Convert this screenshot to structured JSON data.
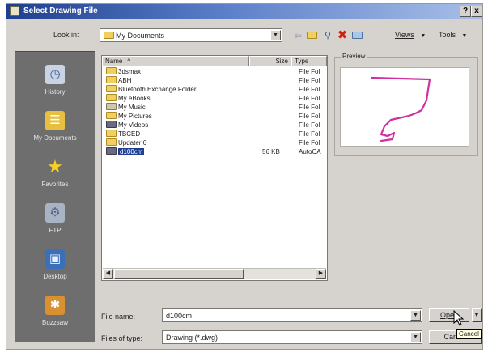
{
  "window": {
    "title": "Select Drawing File",
    "help_btn": "?",
    "close_btn": "x"
  },
  "lookin": {
    "label": "Look in:",
    "value": "My Documents"
  },
  "toolbar": {
    "back_icon": "back-arrow",
    "up_icon": "up-folder",
    "search_icon": "search-web",
    "delete_icon": "delete-x",
    "newfolder_icon": "new-folder",
    "views_label": "Views",
    "tools_label": "Tools",
    "dropdown": "▼"
  },
  "places": [
    {
      "label": "History",
      "icon": "history-icon"
    },
    {
      "label": "My Documents",
      "icon": "my-documents-icon"
    },
    {
      "label": "Favorites",
      "icon": "favorites-icon"
    },
    {
      "label": "FTP",
      "icon": "ftp-icon"
    },
    {
      "label": "Desktop",
      "icon": "desktop-icon"
    },
    {
      "label": "Buzzsaw",
      "icon": "buzzsaw-icon"
    }
  ],
  "filelist": {
    "columns": {
      "name": "Name",
      "size": "Size",
      "type": "Type"
    },
    "rows": [
      {
        "name": "3dsmax",
        "size": "",
        "type": "File Fol",
        "kind": "folder"
      },
      {
        "name": "ABH",
        "size": "",
        "type": "File Fol",
        "kind": "folder"
      },
      {
        "name": "Bluetooth Exchange Folder",
        "size": "",
        "type": "File Fol",
        "kind": "folder"
      },
      {
        "name": "My eBooks",
        "size": "",
        "type": "File Fol",
        "kind": "folder"
      },
      {
        "name": "My Music",
        "size": "",
        "type": "File Fol",
        "kind": "special"
      },
      {
        "name": "My Pictures",
        "size": "",
        "type": "File Fol",
        "kind": "folder"
      },
      {
        "name": "My Videos",
        "size": "",
        "type": "File Fol",
        "kind": "file"
      },
      {
        "name": "TBCED",
        "size": "",
        "type": "File Fol",
        "kind": "folder"
      },
      {
        "name": "Updater 6",
        "size": "",
        "type": "File Fol",
        "kind": "folder"
      },
      {
        "name": "d100cm",
        "size": "56 KB",
        "type": "AutoCA",
        "kind": "dwg",
        "selected": true
      }
    ]
  },
  "preview": {
    "label": "Preview"
  },
  "filename": {
    "label": "File name:",
    "value": "d100cm"
  },
  "filetype": {
    "label": "Files of type:",
    "value": "Drawing (*.dwg)"
  },
  "buttons": {
    "open": "Open",
    "cancel": "Cancel"
  },
  "tooltip": {
    "text": "Cancel"
  },
  "colors": {
    "titlebar": "#1e3f8f",
    "dialog_bg": "#d6d3ce",
    "places_bg": "#6f6e6e",
    "preview_stroke": "#d030a0"
  }
}
